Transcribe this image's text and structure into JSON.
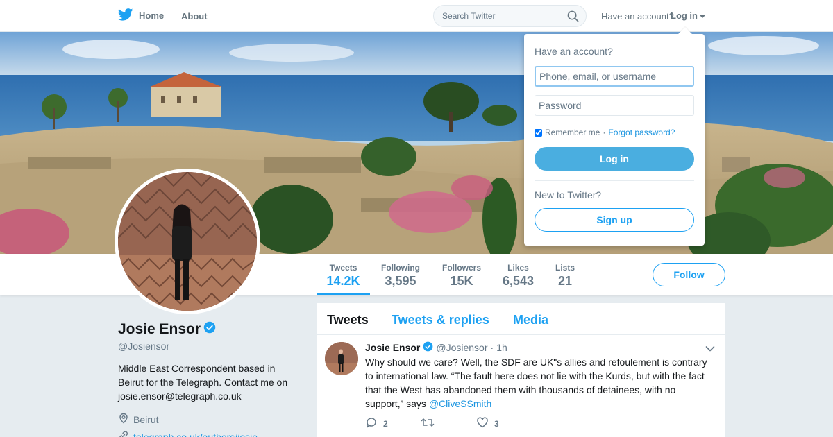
{
  "nav": {
    "home_label": "Home",
    "about_label": "About",
    "search_placeholder": "Search Twitter",
    "account_prompt": "Have an account?",
    "login_label": "Log in"
  },
  "profile": {
    "name": "Josie Ensor",
    "handle": "@Josiensor",
    "bio": "Middle East Correspondent based in Beirut for the Telegraph. Contact me on josie.ensor@telegraph.co.uk",
    "location": "Beirut",
    "url": "telegraph.co.uk/authors/josie..."
  },
  "stats": [
    {
      "label": "Tweets",
      "value": "14.2K"
    },
    {
      "label": "Following",
      "value": "3,595"
    },
    {
      "label": "Followers",
      "value": "15K"
    },
    {
      "label": "Likes",
      "value": "6,543"
    },
    {
      "label": "Lists",
      "value": "21"
    }
  ],
  "follow_label": "Follow",
  "timeline": {
    "tabs": [
      "Tweets",
      "Tweets & replies",
      "Media"
    ],
    "tweet": {
      "name": "Josie Ensor",
      "handle": "@Josiensor",
      "separator": "·",
      "time": "1h",
      "text": "Why should we care? Well, the SDF are UK\"s allies and refoulement is contrary to international law. “The fault here does not lie with the Kurds, but with the fact that the West has abandoned them with thousands of detainees, with no support,” says ",
      "mention": "@CliveSSmith",
      "replies": "2",
      "retweets": "",
      "likes": "3"
    }
  },
  "login_dropdown": {
    "title": "Have an account?",
    "username_placeholder": "Phone, email, or username",
    "password_placeholder": "Password",
    "remember_label": "Remember me",
    "separator": "·",
    "forgot_label": "Forgot password?",
    "login_button": "Log in",
    "new_prompt": "New to Twitter?",
    "signup_button": "Sign up"
  },
  "colors": {
    "brand": "#1da1f2",
    "link": "#1b95e0",
    "login_button": "#4aaee0"
  }
}
